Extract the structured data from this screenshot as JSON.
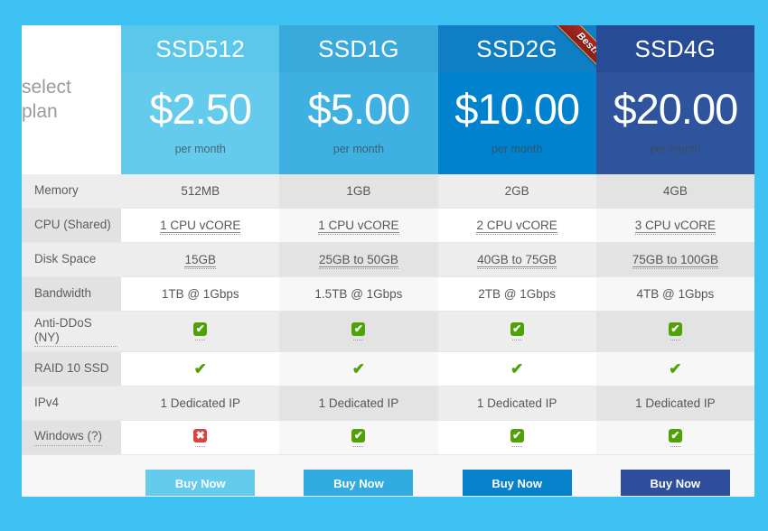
{
  "page": {
    "background_color": "#3ec1f3",
    "table_background": "#ffffff"
  },
  "select_cell": {
    "line1": "select",
    "line2": "plan"
  },
  "ribbon": {
    "label": "Best!",
    "on_plan": "SSD2G",
    "color": "#98251d",
    "border_color": "#d8b45a"
  },
  "plans": [
    {
      "name": "SSD512",
      "price": "$2.50",
      "per": "per month",
      "header_color": "#5bc8eb",
      "price_color": "#64cbec",
      "button_color": "#64cbec",
      "button_label": "Buy Now"
    },
    {
      "name": "SSD1G",
      "price": "$5.00",
      "per": "per month",
      "header_color": "#3aa9dc",
      "price_color": "#3eb1e2",
      "button_color": "#32ace0",
      "button_label": "Buy Now"
    },
    {
      "name": "SSD2G",
      "price": "$10.00",
      "per": "per month",
      "header_color": "#0f7ec4",
      "price_color": "#0082ce",
      "button_color": "#0682cc",
      "button_label": "Buy Now"
    },
    {
      "name": "SSD4G",
      "price": "$20.00",
      "per": "per month",
      "header_color": "#254c95",
      "price_color": "#2f549e",
      "button_color": "#2f4f9e",
      "button_label": "Buy Now"
    }
  ],
  "features": [
    {
      "label": "Memory",
      "label_dotted": false,
      "style": "text",
      "values": [
        "512MB",
        "1GB",
        "2GB",
        "4GB"
      ],
      "value_dotted": false
    },
    {
      "label": "CPU (Shared)",
      "label_dotted": false,
      "style": "text",
      "values": [
        "1 CPU vCORE",
        "1 CPU vCORE",
        "2 CPU vCORE",
        "3 CPU vCORE"
      ],
      "value_dotted": true
    },
    {
      "label": "Disk Space",
      "label_dotted": false,
      "style": "text",
      "values": [
        "15GB",
        "25GB to 50GB",
        "40GB to 75GB",
        "75GB to 100GB"
      ],
      "value_dotted": true
    },
    {
      "label": "Bandwidth",
      "label_dotted": false,
      "style": "text",
      "values": [
        "1TB @ 1Gbps",
        "1.5TB @ 1Gbps",
        "2TB @ 1Gbps",
        "4TB @ 1Gbps"
      ],
      "value_dotted": false
    },
    {
      "label": "Anti-DDoS (NY)",
      "label_dotted": true,
      "style": "icon-box",
      "values": [
        "yes",
        "yes",
        "yes",
        "yes"
      ],
      "value_dotted": true
    },
    {
      "label": "RAID 10 SSD",
      "label_dotted": false,
      "style": "icon-plain",
      "values": [
        "yes",
        "yes",
        "yes",
        "yes"
      ],
      "value_dotted": false
    },
    {
      "label": "IPv4",
      "label_dotted": false,
      "style": "text",
      "values": [
        "1 Dedicated IP",
        "1 Dedicated IP",
        "1 Dedicated IP",
        "1 Dedicated IP"
      ],
      "value_dotted": false
    },
    {
      "label": "Windows (?)",
      "label_dotted": true,
      "style": "icon-box",
      "values": [
        "no",
        "yes",
        "yes",
        "yes"
      ],
      "value_dotted": true
    }
  ],
  "icons": {
    "yes_glyph": "✔",
    "no_glyph": "✖",
    "yes_color": "#4fa108",
    "no_color": "#d9453e",
    "plain_check_glyph": "✔"
  }
}
